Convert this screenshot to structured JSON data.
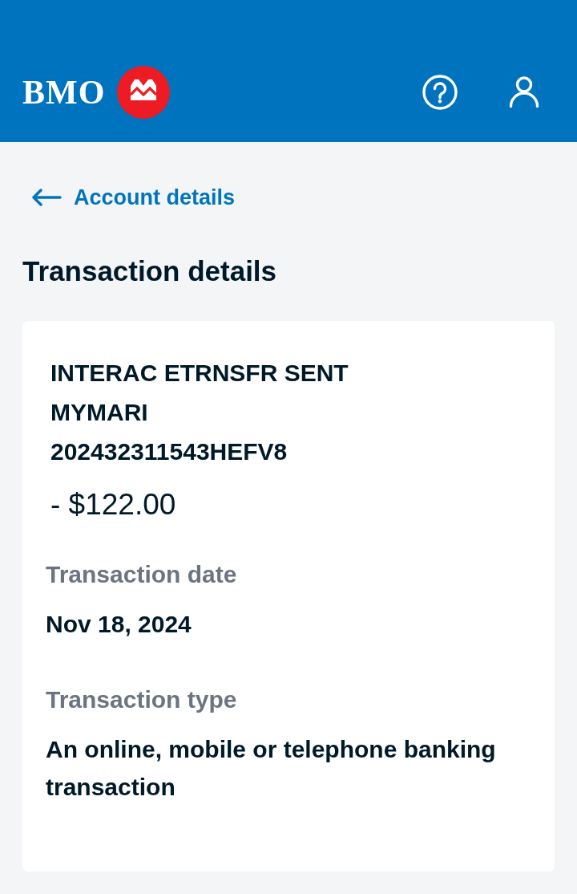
{
  "header": {
    "logo_text": "BMO"
  },
  "back_link": {
    "label": "Account details"
  },
  "page_title": "Transaction details",
  "transaction": {
    "description_lines": [
      "INTERAC ETRNSFR SENT",
      "MYMARI",
      "202432311543HEFV8"
    ],
    "amount": "- $122.00",
    "fields": [
      {
        "label": "Transaction date",
        "value": "Nov 18, 2024"
      },
      {
        "label": "Transaction type",
        "value": "An online, mobile or telephone banking transaction"
      }
    ]
  }
}
